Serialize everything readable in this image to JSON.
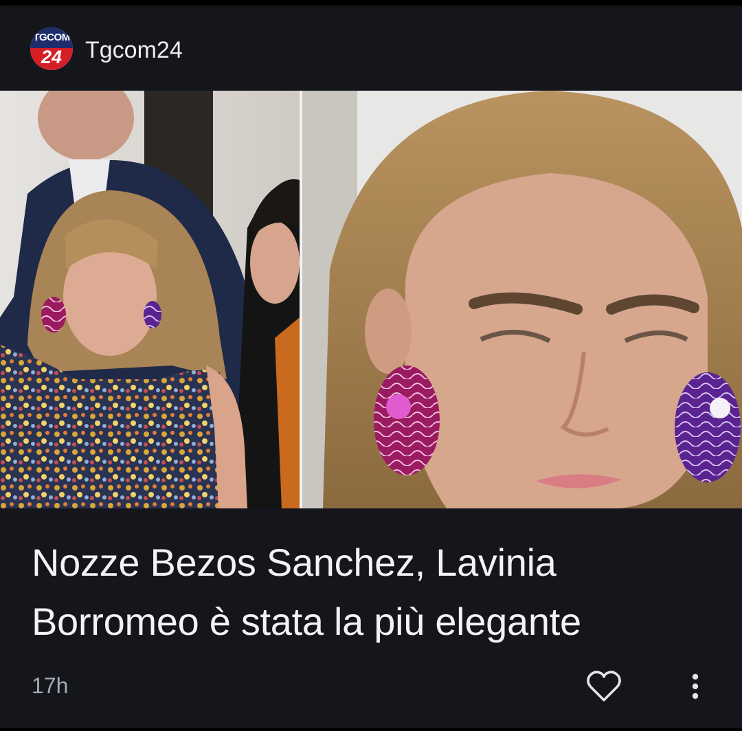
{
  "source": {
    "name": "Tgcom24",
    "logo_top_text": "TGCOM",
    "logo_bottom_text": "24",
    "logo_icon": "tgcom24-logo-icon"
  },
  "article": {
    "headline": "Nozze Bezos Sanchez, Lavinia Borromeo è stata la più elegante",
    "time": "17h"
  },
  "actions": {
    "like_icon": "heart-icon",
    "more_icon": "more-vertical-icon"
  },
  "colors": {
    "card_background": "#15161b",
    "logo_blue": "#1e2d6b",
    "logo_red": "#d41f26",
    "earring_magenta": "#b0226e",
    "earring_violet": "#6a2a9a"
  }
}
